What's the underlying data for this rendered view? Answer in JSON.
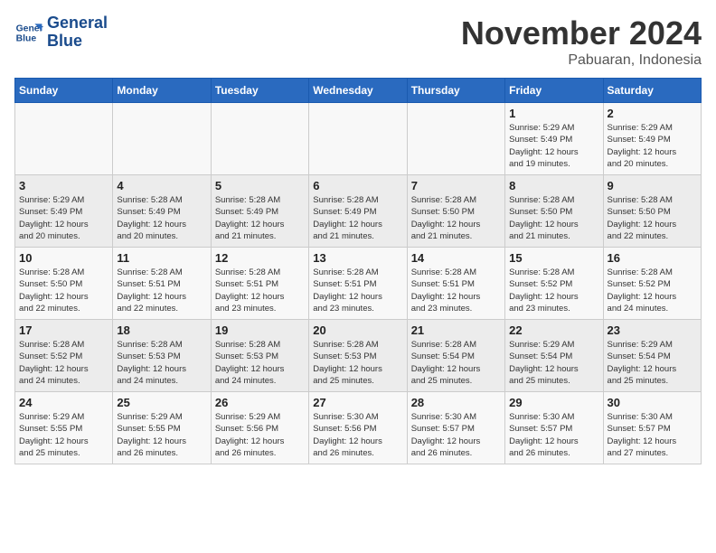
{
  "logo": {
    "line1": "General",
    "line2": "Blue"
  },
  "title": "November 2024",
  "location": "Pabuaran, Indonesia",
  "days_of_week": [
    "Sunday",
    "Monday",
    "Tuesday",
    "Wednesday",
    "Thursday",
    "Friday",
    "Saturday"
  ],
  "weeks": [
    [
      {
        "day": "",
        "info": ""
      },
      {
        "day": "",
        "info": ""
      },
      {
        "day": "",
        "info": ""
      },
      {
        "day": "",
        "info": ""
      },
      {
        "day": "",
        "info": ""
      },
      {
        "day": "1",
        "info": "Sunrise: 5:29 AM\nSunset: 5:49 PM\nDaylight: 12 hours\nand 19 minutes."
      },
      {
        "day": "2",
        "info": "Sunrise: 5:29 AM\nSunset: 5:49 PM\nDaylight: 12 hours\nand 20 minutes."
      }
    ],
    [
      {
        "day": "3",
        "info": "Sunrise: 5:29 AM\nSunset: 5:49 PM\nDaylight: 12 hours\nand 20 minutes."
      },
      {
        "day": "4",
        "info": "Sunrise: 5:28 AM\nSunset: 5:49 PM\nDaylight: 12 hours\nand 20 minutes."
      },
      {
        "day": "5",
        "info": "Sunrise: 5:28 AM\nSunset: 5:49 PM\nDaylight: 12 hours\nand 21 minutes."
      },
      {
        "day": "6",
        "info": "Sunrise: 5:28 AM\nSunset: 5:49 PM\nDaylight: 12 hours\nand 21 minutes."
      },
      {
        "day": "7",
        "info": "Sunrise: 5:28 AM\nSunset: 5:50 PM\nDaylight: 12 hours\nand 21 minutes."
      },
      {
        "day": "8",
        "info": "Sunrise: 5:28 AM\nSunset: 5:50 PM\nDaylight: 12 hours\nand 21 minutes."
      },
      {
        "day": "9",
        "info": "Sunrise: 5:28 AM\nSunset: 5:50 PM\nDaylight: 12 hours\nand 22 minutes."
      }
    ],
    [
      {
        "day": "10",
        "info": "Sunrise: 5:28 AM\nSunset: 5:50 PM\nDaylight: 12 hours\nand 22 minutes."
      },
      {
        "day": "11",
        "info": "Sunrise: 5:28 AM\nSunset: 5:51 PM\nDaylight: 12 hours\nand 22 minutes."
      },
      {
        "day": "12",
        "info": "Sunrise: 5:28 AM\nSunset: 5:51 PM\nDaylight: 12 hours\nand 23 minutes."
      },
      {
        "day": "13",
        "info": "Sunrise: 5:28 AM\nSunset: 5:51 PM\nDaylight: 12 hours\nand 23 minutes."
      },
      {
        "day": "14",
        "info": "Sunrise: 5:28 AM\nSunset: 5:51 PM\nDaylight: 12 hours\nand 23 minutes."
      },
      {
        "day": "15",
        "info": "Sunrise: 5:28 AM\nSunset: 5:52 PM\nDaylight: 12 hours\nand 23 minutes."
      },
      {
        "day": "16",
        "info": "Sunrise: 5:28 AM\nSunset: 5:52 PM\nDaylight: 12 hours\nand 24 minutes."
      }
    ],
    [
      {
        "day": "17",
        "info": "Sunrise: 5:28 AM\nSunset: 5:52 PM\nDaylight: 12 hours\nand 24 minutes."
      },
      {
        "day": "18",
        "info": "Sunrise: 5:28 AM\nSunset: 5:53 PM\nDaylight: 12 hours\nand 24 minutes."
      },
      {
        "day": "19",
        "info": "Sunrise: 5:28 AM\nSunset: 5:53 PM\nDaylight: 12 hours\nand 24 minutes."
      },
      {
        "day": "20",
        "info": "Sunrise: 5:28 AM\nSunset: 5:53 PM\nDaylight: 12 hours\nand 25 minutes."
      },
      {
        "day": "21",
        "info": "Sunrise: 5:28 AM\nSunset: 5:54 PM\nDaylight: 12 hours\nand 25 minutes."
      },
      {
        "day": "22",
        "info": "Sunrise: 5:29 AM\nSunset: 5:54 PM\nDaylight: 12 hours\nand 25 minutes."
      },
      {
        "day": "23",
        "info": "Sunrise: 5:29 AM\nSunset: 5:54 PM\nDaylight: 12 hours\nand 25 minutes."
      }
    ],
    [
      {
        "day": "24",
        "info": "Sunrise: 5:29 AM\nSunset: 5:55 PM\nDaylight: 12 hours\nand 25 minutes."
      },
      {
        "day": "25",
        "info": "Sunrise: 5:29 AM\nSunset: 5:55 PM\nDaylight: 12 hours\nand 26 minutes."
      },
      {
        "day": "26",
        "info": "Sunrise: 5:29 AM\nSunset: 5:56 PM\nDaylight: 12 hours\nand 26 minutes."
      },
      {
        "day": "27",
        "info": "Sunrise: 5:30 AM\nSunset: 5:56 PM\nDaylight: 12 hours\nand 26 minutes."
      },
      {
        "day": "28",
        "info": "Sunrise: 5:30 AM\nSunset: 5:57 PM\nDaylight: 12 hours\nand 26 minutes."
      },
      {
        "day": "29",
        "info": "Sunrise: 5:30 AM\nSunset: 5:57 PM\nDaylight: 12 hours\nand 26 minutes."
      },
      {
        "day": "30",
        "info": "Sunrise: 5:30 AM\nSunset: 5:57 PM\nDaylight: 12 hours\nand 27 minutes."
      }
    ]
  ]
}
